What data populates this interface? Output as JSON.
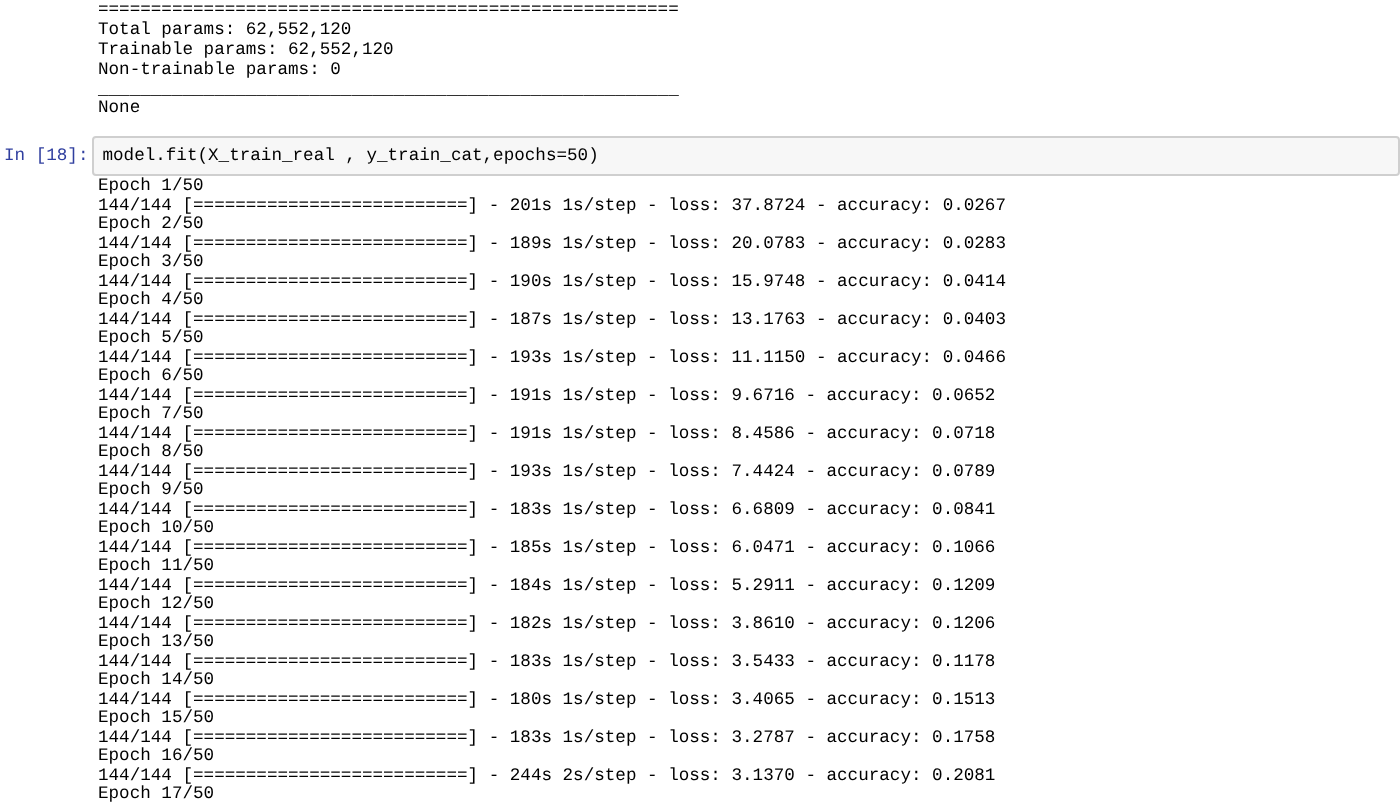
{
  "cells": [
    {
      "kind": "output",
      "lines": [
        "=======================================================",
        "Total params: 62,552,120",
        "Trainable params: 62,552,120",
        "Non-trainable params: 0",
        "_______________________________________________________",
        "None"
      ]
    },
    {
      "kind": "code",
      "prompt": "In [18]:",
      "source": "model.fit(X_train_real , y_train_cat,epochs=50)"
    },
    {
      "kind": "output",
      "lines": [
        "Epoch 1/50",
        "144/144 [==========================] - 201s 1s/step - loss: 37.8724 - accuracy: 0.0267",
        "Epoch 2/50",
        "144/144 [==========================] - 189s 1s/step - loss: 20.0783 - accuracy: 0.0283",
        "Epoch 3/50",
        "144/144 [==========================] - 190s 1s/step - loss: 15.9748 - accuracy: 0.0414",
        "Epoch 4/50",
        "144/144 [==========================] - 187s 1s/step - loss: 13.1763 - accuracy: 0.0403",
        "Epoch 5/50",
        "144/144 [==========================] - 193s 1s/step - loss: 11.1150 - accuracy: 0.0466",
        "Epoch 6/50",
        "144/144 [==========================] - 191s 1s/step - loss: 9.6716 - accuracy: 0.0652",
        "Epoch 7/50",
        "144/144 [==========================] - 191s 1s/step - loss: 8.4586 - accuracy: 0.0718",
        "Epoch 8/50",
        "144/144 [==========================] - 193s 1s/step - loss: 7.4424 - accuracy: 0.0789",
        "Epoch 9/50",
        "144/144 [==========================] - 183s 1s/step - loss: 6.6809 - accuracy: 0.0841",
        "Epoch 10/50",
        "144/144 [==========================] - 185s 1s/step - loss: 6.0471 - accuracy: 0.1066",
        "Epoch 11/50",
        "144/144 [==========================] - 184s 1s/step - loss: 5.2911 - accuracy: 0.1209",
        "Epoch 12/50",
        "144/144 [==========================] - 182s 1s/step - loss: 3.8610 - accuracy: 0.1206",
        "Epoch 13/50",
        "144/144 [==========================] - 183s 1s/step - loss: 3.5433 - accuracy: 0.1178",
        "Epoch 14/50",
        "144/144 [==========================] - 180s 1s/step - loss: 3.4065 - accuracy: 0.1513",
        "Epoch 15/50",
        "144/144 [==========================] - 183s 1s/step - loss: 3.2787 - accuracy: 0.1758",
        "Epoch 16/50",
        "144/144 [==========================] - 244s 2s/step - loss: 3.1370 - accuracy: 0.2081",
        "Epoch 17/50"
      ]
    }
  ]
}
